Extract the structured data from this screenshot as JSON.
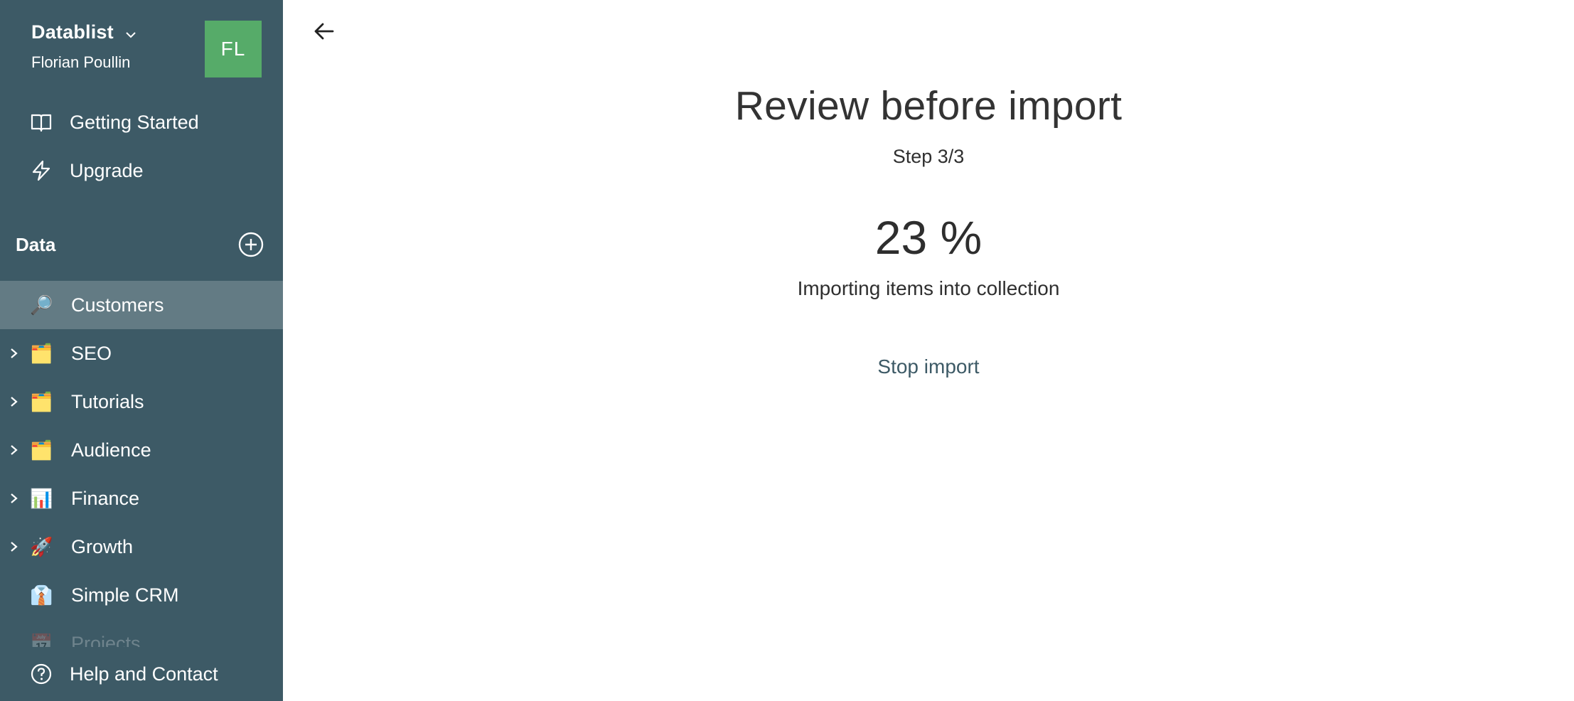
{
  "sidebar": {
    "workspace": {
      "name": "Datablist",
      "user": "Florian Poullin",
      "avatar_initials": "FL",
      "avatar_color": "#56ab69"
    },
    "nav": [
      {
        "label": "Getting Started",
        "icon": "book-open-icon"
      },
      {
        "label": "Upgrade",
        "icon": "lightning-icon"
      }
    ],
    "data_section": {
      "title": "Data",
      "add_icon": "plus-circle-icon"
    },
    "data_items": [
      {
        "label": "Customers",
        "emoji": "🔎",
        "icon": "magnifier-icon",
        "expandable": false,
        "selected": true
      },
      {
        "label": "SEO",
        "emoji": "🗂️",
        "icon": "card-index-dividers-icon",
        "expandable": true,
        "selected": false
      },
      {
        "label": "Tutorials",
        "emoji": "🗂️",
        "icon": "card-index-dividers-icon",
        "expandable": true,
        "selected": false
      },
      {
        "label": "Audience",
        "emoji": "🗂️",
        "icon": "card-index-dividers-icon",
        "expandable": true,
        "selected": false
      },
      {
        "label": "Finance",
        "emoji": "📊",
        "icon": "bar-chart-icon",
        "expandable": true,
        "selected": false
      },
      {
        "label": "Growth",
        "emoji": "🚀",
        "icon": "rocket-icon",
        "expandable": true,
        "selected": false
      },
      {
        "label": "Simple CRM",
        "emoji": "👔",
        "icon": "necktie-icon",
        "expandable": false,
        "selected": false
      },
      {
        "label": "Projects",
        "emoji": "📅",
        "icon": "calendar-icon",
        "expandable": false,
        "selected": false
      }
    ],
    "help": {
      "label": "Help and Contact",
      "icon": "question-circle-icon"
    },
    "colors": {
      "background": "#3d5a66",
      "selected": "#637b84"
    }
  },
  "main": {
    "back_icon": "arrow-left-icon",
    "title": "Review before import",
    "step": "Step 3/3",
    "progress_percent": 23,
    "progress_label": "23 %",
    "status": "Importing items into collection",
    "stop_label": "Stop import",
    "accent_color": "#3d5a66"
  }
}
